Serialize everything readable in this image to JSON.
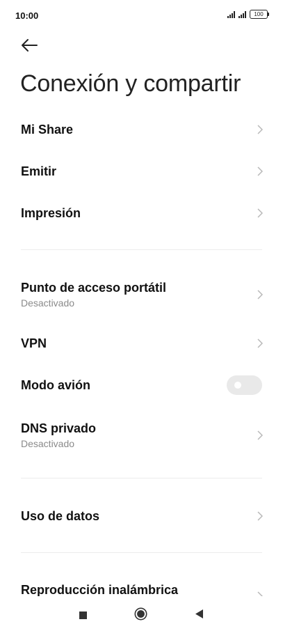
{
  "status_bar": {
    "time": "10:00",
    "battery": "100"
  },
  "title": "Conexión y compartir",
  "items": [
    {
      "label": "Mi Share"
    },
    {
      "label": "Emitir"
    },
    {
      "label": "Impresión"
    },
    {
      "label": "Punto de acceso portátil",
      "sub": "Desactivado"
    },
    {
      "label": "VPN"
    },
    {
      "label": "Modo avión",
      "toggle": false
    },
    {
      "label": "DNS privado",
      "sub": "Desactivado"
    },
    {
      "label": "Uso de datos"
    },
    {
      "label": "Reproducción inalámbrica"
    }
  ],
  "icons": {
    "back": "arrow-left-icon",
    "chevron": "chevron-right-icon",
    "nav": [
      "square-recents-icon",
      "circle-home-icon",
      "triangle-back-icon"
    ]
  },
  "colors": {
    "background": "#ffffff",
    "text": "#111111",
    "secondary_text": "#8a8a8a",
    "toggle_off": "#e9e9e9"
  }
}
